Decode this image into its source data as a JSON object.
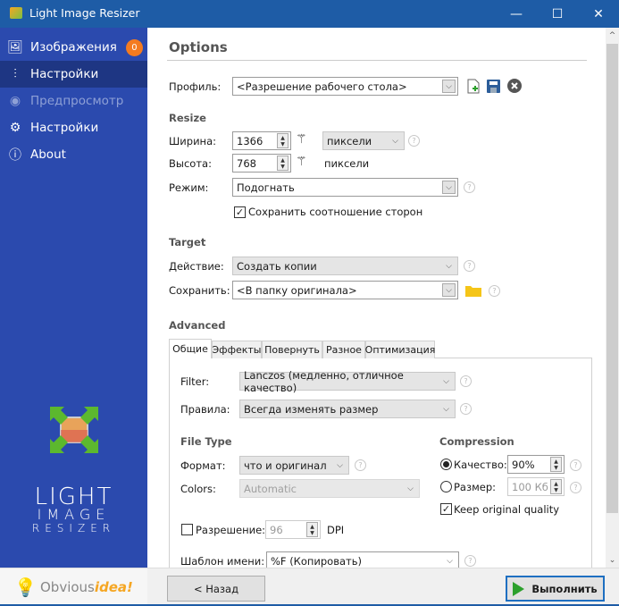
{
  "window": {
    "title": "Light Image Resizer",
    "minimize_icon": "—",
    "maximize_icon": "☐",
    "close_icon": "✕"
  },
  "sidebar": {
    "items": [
      {
        "label": "Изображения",
        "icon": "images-icon",
        "glyph": "🖼",
        "badge": "0"
      },
      {
        "label": "Настройки",
        "icon": "sliders-icon",
        "glyph": "⫶",
        "active": true
      },
      {
        "label": "Предпросмотр",
        "icon": "eye-icon",
        "glyph": "◉",
        "disabled": true
      },
      {
        "label": "Настройки",
        "icon": "gear-icon",
        "glyph": "⚙"
      },
      {
        "label": "About",
        "icon": "info-icon",
        "glyph": "ⓘ"
      }
    ],
    "logo": {
      "line1": "LIGHT",
      "line2": "IMAGE",
      "line3": "RESIZER"
    },
    "footer": {
      "brand1": "Obvious",
      "brand2": "idea!",
      "bulb": "💡"
    }
  },
  "options": {
    "title": "Options",
    "profile": {
      "label": "Профиль:",
      "value": "<Разрешение рабочего стола>"
    },
    "resize": {
      "heading": "Resize",
      "width_label": "Ширина:",
      "width_value": "1366",
      "height_label": "Высота:",
      "height_value": "768",
      "unit_value": "пиксели",
      "unit_static": "пиксели",
      "mode_label": "Режим:",
      "mode_value": "Подогнать",
      "keep_ratio_label": "Сохранить соотношение сторон",
      "keep_ratio_checked": true
    },
    "target": {
      "heading": "Target",
      "action_label": "Действие:",
      "action_value": "Создать копии",
      "save_label": "Сохранить:",
      "save_value": "<В папку оригинала>"
    },
    "advanced": {
      "heading": "Advanced",
      "tabs": [
        "Общие",
        "Эффекты",
        "Повернуть",
        "Разное",
        "Оптимизация"
      ],
      "active_tab": "Общие",
      "filter_label": "Filter:",
      "filter_value": "Lanczos  (медленно, отличное качество)",
      "rules_label": "Правила:",
      "rules_value": "Всегда изменять размер",
      "filetype_heading": "File Type",
      "format_label": "Формат:",
      "format_value": "что и оригинал",
      "colors_label": "Colors:",
      "colors_value": "Automatic",
      "compression_heading": "Compression",
      "quality_label": "Качество:",
      "quality_value": "90%",
      "quality_selected": true,
      "size_label": "Размер:",
      "size_value": "100 Кб",
      "keep_quality_label": "Keep original quality",
      "keep_quality_checked": true,
      "resolution_label": "Разрешение:",
      "resolution_value": "96",
      "resolution_unit": "DPI",
      "resolution_checked": false,
      "name_template_label": "Шаблон имени:",
      "name_template_value": "%F (Копировать)"
    }
  },
  "footer": {
    "back_label": "< Назад",
    "run_label": "Выполнить"
  },
  "glyphs": {
    "check": "✓",
    "chevron": "⌵",
    "help": "?",
    "up": "▲",
    "down": "▼",
    "scroll_up": "^",
    "scroll_down": "⌄"
  }
}
